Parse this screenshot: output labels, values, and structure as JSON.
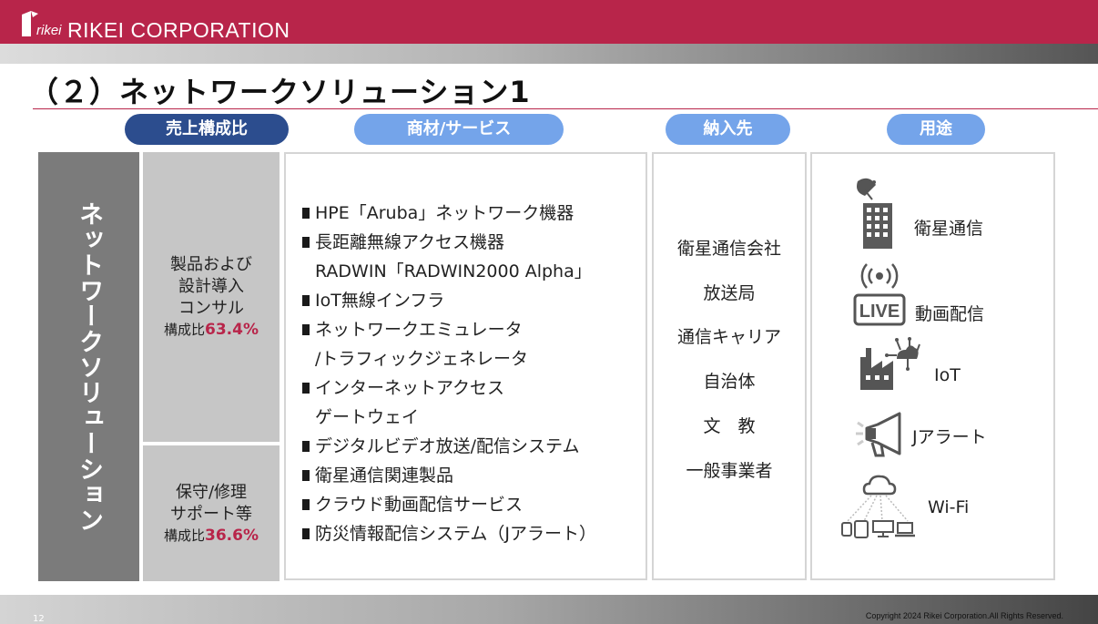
{
  "header": {
    "logo_small": "rikei",
    "company": "RIKEI CORPORATION",
    "brand_color": "#b8254a"
  },
  "title": "（２）ネットワークソリューション1",
  "columns": {
    "share": "売上構成比",
    "products": "商材/サービス",
    "customers": "納入先",
    "uses": "用途"
  },
  "segment": "ネットワークソリューション",
  "shares": [
    {
      "lines": [
        "製品および",
        "設計導入",
        "コンサル"
      ],
      "ratio_label": "構成比",
      "ratio": "63.4%"
    },
    {
      "lines": [
        "保守/修理",
        "サポート等"
      ],
      "ratio_label": "構成比",
      "ratio": "36.6%"
    }
  ],
  "products": [
    {
      "text": "HPE「Aruba」ネットワーク機器",
      "bullet": true
    },
    {
      "text": "長距離無線アクセス機器",
      "bullet": true
    },
    {
      "text": "RADWIN「RADWIN2000 Alpha」",
      "bullet": false
    },
    {
      "text": "IoT無線インフラ",
      "bullet": true
    },
    {
      "text": "ネットワークエミュレータ",
      "bullet": true
    },
    {
      "text": "/トラフィックジェネレータ",
      "bullet": false
    },
    {
      "text": "インターネットアクセス",
      "bullet": true
    },
    {
      "text": "ゲートウェイ",
      "bullet": false
    },
    {
      "text": "デジタルビデオ放送/配信システム",
      "bullet": true
    },
    {
      "text": "衛星通信関連製品",
      "bullet": true
    },
    {
      "text": "クラウド動画配信サービス",
      "bullet": true
    },
    {
      "text": "防災情報配信システム（Jアラート）",
      "bullet": true
    }
  ],
  "customers": [
    "衛星通信会社",
    "放送局",
    "通信キャリア",
    "自治体",
    "文　教",
    "一般事業者"
  ],
  "uses": [
    {
      "label": "衛星通信",
      "icon": "satellite-building-icon"
    },
    {
      "label": "動画配信",
      "icon": "live-broadcast-icon"
    },
    {
      "label": "IoT",
      "icon": "iot-factory-icon"
    },
    {
      "label": "Jアラート",
      "icon": "megaphone-icon"
    },
    {
      "label": "Wi-Fi",
      "icon": "cloud-devices-icon"
    }
  ],
  "icon_texts": {
    "live": "LIVE"
  },
  "footer": {
    "page": "12",
    "copyright": "Copyright 2024 Rikei Corporation.All Rights Reserved."
  },
  "colors": {
    "pill_dark": "#2c4d8e",
    "pill_light": "#74a4ea",
    "segment_gray": "#7b7b7b",
    "share_gray": "#c6c6c6",
    "accent": "#b8254a"
  }
}
